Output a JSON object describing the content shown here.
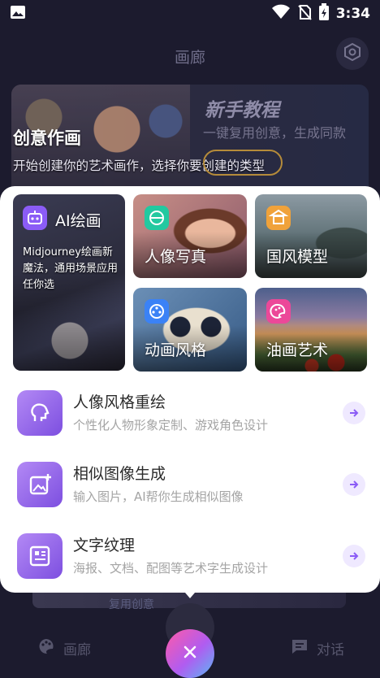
{
  "status_bar": {
    "time": "3:34",
    "icons": [
      "image-icon",
      "wifi-icon",
      "no-sim-icon",
      "battery-charging-icon"
    ]
  },
  "header": {
    "title": "画廊",
    "settings_icon": "settings-hexagon-icon"
  },
  "banner": {
    "title": "创意作画",
    "subtitle": "开始创建你的艺术画作，选择你要创建的类型",
    "tutorial_title": "新手教程",
    "tutorial_subtitle": "一键复用创意，生成同款"
  },
  "cards": {
    "ai": {
      "label": "AI绘画",
      "description": "Midjourney绘画新魔法，通用场景应用任你选",
      "icon": "robot-icon",
      "icon_color": "#8b5cf6"
    },
    "portrait": {
      "label": "人像写真",
      "icon": "portrait-icon",
      "icon_color": "#22c9a0"
    },
    "guofeng": {
      "label": "国风模型",
      "icon": "pavilion-icon",
      "icon_color": "#f0a23a"
    },
    "anime": {
      "label": "动画风格",
      "icon": "film-reel-icon",
      "icon_color": "#3b82f6"
    },
    "oil": {
      "label": "油画艺术",
      "icon": "palette-icon",
      "icon_color": "#ec4899"
    }
  },
  "features": [
    {
      "title": "人像风格重绘",
      "subtitle": "个性化人物形象定制、游戏角色设计",
      "icon": "head-brush-icon"
    },
    {
      "title": "相似图像生成",
      "subtitle": "输入图片，AI帮你生成相似图像",
      "icon": "image-plus-icon"
    },
    {
      "title": "文字纹理",
      "subtitle": "海报、文档、配图等艺术字生成设计",
      "icon": "text-texture-icon"
    }
  ],
  "bottom_nav": {
    "peek_text": "复用创意",
    "gallery_label": "画廊",
    "chat_label": "对话",
    "fab_icon": "close-icon"
  },
  "colors": {
    "background": "#1c1b2e",
    "sheet": "#ffffff",
    "accent_purple": "#7d4fe0",
    "arrow_bg": "#efe9ff"
  }
}
